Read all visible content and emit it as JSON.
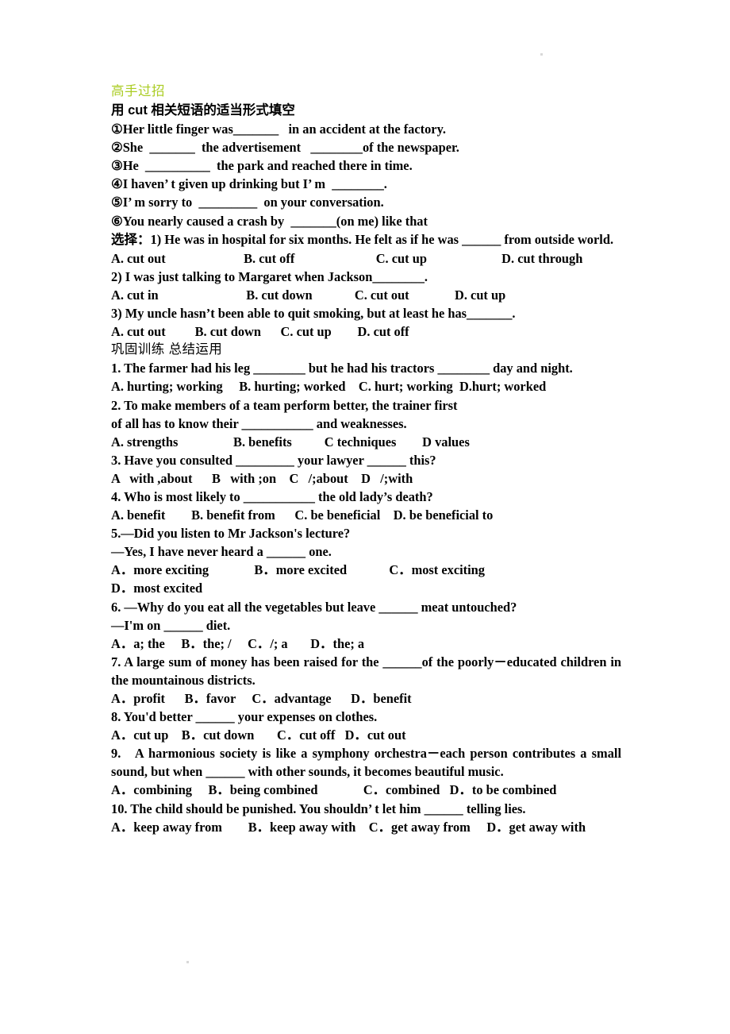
{
  "document": {
    "title_cn": "高手过招",
    "title_color": "#AACC22",
    "instruction_cn": "用 cut 相关短语的适当形式填空",
    "fill_in_items": [
      "①Her little finger was_______   in an accident at the factory.",
      "②She  _______  the advertisement   ________of the newspaper.",
      "③He  __________  the park and reached there in time.",
      "④I haven’ t given up drinking but I’ m  ________.",
      "⑤I’ m sorry to  _________  on your conversation.",
      "⑥You nearly caused a crash by  _______(on me) like that"
    ],
    "choice_section_label_cn": "选择：",
    "choice_questions": [
      {
        "stem": "1) He was in hospital for six months. He felt as if he was ______ from outside world.",
        "options_line": "A. cut out                        B. cut off                         C. cut up                       D. cut through"
      },
      {
        "stem": "2) I was just talking to Margaret when Jackson________.",
        "options_line": "A. cut in                           B. cut down             C. cut out              D. cut up"
      },
      {
        "stem": "3) My uncle hasn’t been able to quit smoking, but at least he has_______.",
        "options_line": "A. cut out         B. cut down      C. cut up        D. cut off"
      }
    ],
    "practice_section_label_cn": "巩固训练  总结运用",
    "practice_questions": [
      {
        "number": "1.",
        "stem": "1. The farmer had his leg ________ but he had his tractors ________ day and night.",
        "options_line": "A. hurting; working     B. hurting; worked    C. hurt; working  D.hurt; worked"
      },
      {
        "number": "2.",
        "stem": "2. To make members of a team perform better, the trainer first",
        "stem2": "of all has to know their ___________ and weaknesses.",
        "options_line": "A. strengths                 B. benefits          C techniques        D values"
      },
      {
        "number": "3.",
        "stem": "3. Have you consulted _________ your lawyer ______ this?",
        "options_line": "A   with ,about      B   with ;on    C   /;about    D   /;with"
      },
      {
        "number": "4.",
        "stem": "4. Who is most likely to ___________ the old lady’s death?",
        "options_line": "A. benefit        B. benefit from      C. be beneficial    D. be beneficial to"
      },
      {
        "number": "5.",
        "stem": "5.—Did you listen to Mr Jackson's lecture?",
        "stem2": "—Yes, I have never heard a ______ one.",
        "options_line": "A．more exciting              B．more excited             C．most exciting",
        "options_line2": "D．most excited"
      },
      {
        "number": "6.",
        "stem": "6. —Why do you eat all the vegetables but leave ______ meat untouched?",
        "stem2": "—I'm on ______ diet.",
        "options_line": "A．a; the     B．the; /     C．/; a       D．the; a"
      },
      {
        "number": "7.",
        "stem": "7. A large sum of money has been raised for the ______of the poorly－educated children in the mountainous districts.",
        "options_line": "A．profit      B．favor     C．advantage      D．benefit"
      },
      {
        "number": "8.",
        "stem": "8. You'd better ______ your expenses on clothes.",
        "options_line": "A．cut up    B．cut down       C．cut off   D．cut out"
      },
      {
        "number": "9.",
        "stem": "9.   A harmonious society is like a symphony orchestra－each person contributes a small sound, but when ______ with other sounds, it becomes beautiful music.",
        "options_line": "A．combining     B．being combined              C．combined   D．to be combined"
      },
      {
        "number": "10.",
        "stem": "10. The child should be punished. You shouldn’ t let him ______ telling lies.",
        "options_line": "A．keep away from        B．keep away with    C．get away from     D．get away with"
      }
    ]
  }
}
